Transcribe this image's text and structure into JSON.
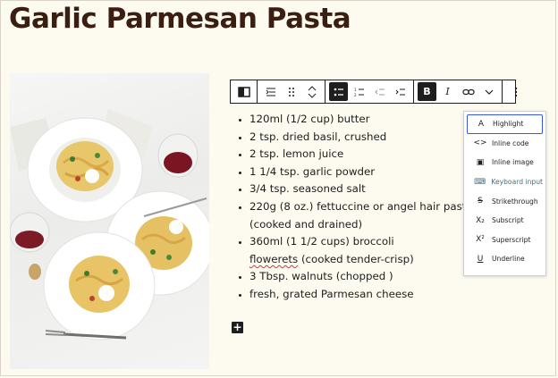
{
  "post": {
    "title": "Garlic Parmesan Pasta"
  },
  "toolbar": {
    "groups": [
      {
        "buttons": [
          {
            "icon": "block-type-icon"
          }
        ]
      },
      {
        "buttons": [
          {
            "icon": "indent-icon"
          },
          {
            "icon": "drag-handle-icon"
          },
          {
            "icon": "move-up-down-icon"
          }
        ]
      },
      {
        "buttons": [
          {
            "icon": "unordered-list-icon",
            "active": true
          },
          {
            "icon": "ordered-list-icon"
          },
          {
            "icon": "outdent-list-icon"
          },
          {
            "icon": "indent-list-icon"
          }
        ]
      },
      {
        "buttons": [
          {
            "icon": "bold-icon",
            "active": true,
            "label": "B"
          },
          {
            "icon": "italic-icon",
            "label": "I"
          },
          {
            "icon": "link-icon"
          },
          {
            "icon": "chevron-down-icon"
          }
        ]
      },
      {
        "buttons": [
          {
            "icon": "more-options-icon"
          }
        ]
      }
    ]
  },
  "ingredients": [
    "120ml (1/2 cup) butter",
    "2 tsp. dried basil, crushed",
    "2 tsp. lemon juice",
    "1 1/4 tsp. garlic powder",
    "3/4 tsp. seasoned salt",
    "220g (8 oz.) fettuccine or angel hair pasta (cooked and drained)",
    "360ml (1 1/2 cups) broccoli",
    "flowerets",
    "(cooked tender-crisp)",
    "3 Tbsp. walnuts (chopped )",
    "fresh, grated Parmesan cheese"
  ],
  "add_block_label": "+",
  "format_menu": {
    "items": [
      {
        "icon_glyph": "A",
        "label": "Highlight",
        "focused": true
      },
      {
        "icon_glyph": "<>",
        "label": "Inline code"
      },
      {
        "icon_glyph": "▣",
        "label": "Inline image"
      },
      {
        "icon_glyph": "⌨",
        "label": "Keyboard input",
        "disabled": true
      },
      {
        "icon_glyph": "S",
        "label": "Strikethrough"
      },
      {
        "icon_glyph": "X₂",
        "label": "Subscript"
      },
      {
        "icon_glyph": "X²",
        "label": "Superscript"
      },
      {
        "icon_glyph": "U",
        "label": "Underline"
      }
    ]
  },
  "colors": {
    "page_bg": "#fdfaf0",
    "title": "#3a1e12",
    "toolbar_active": "#1e1e1e",
    "focus_ring": "#3858e9",
    "spellcheck": "#d63638"
  }
}
